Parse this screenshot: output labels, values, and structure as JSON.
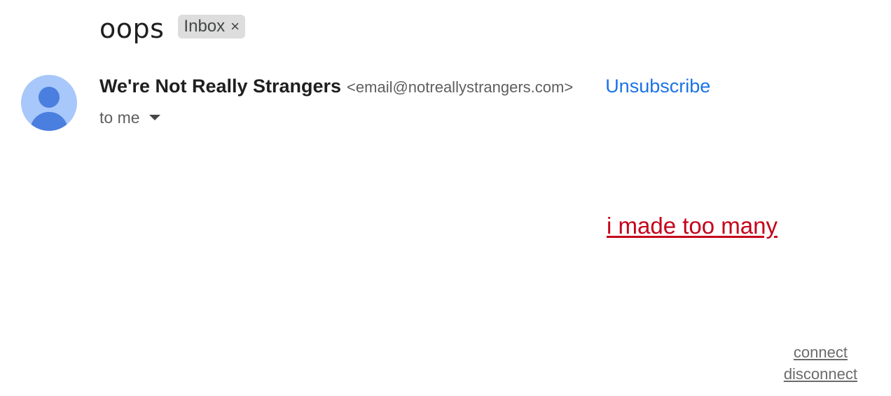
{
  "message": {
    "subject": "oops",
    "label": {
      "text": "Inbox",
      "close_glyph": "×"
    }
  },
  "sender": {
    "name": "We're Not Really Strangers",
    "email": "<email@notreallystrangers.com>",
    "unsubscribe_label": "Unsubscribe",
    "recipient_text": "to me",
    "avatar_icon": "default-person-icon"
  },
  "body": {
    "link_text": "i made too many"
  },
  "footer": {
    "connect_label": "connect",
    "disconnect_label": "disconnect"
  },
  "colors": {
    "unsubscribe": "#1a73e8",
    "body_link": "#c5001a",
    "avatar_bg": "#a8c7fa",
    "avatar_fg": "#4a7fe0"
  }
}
